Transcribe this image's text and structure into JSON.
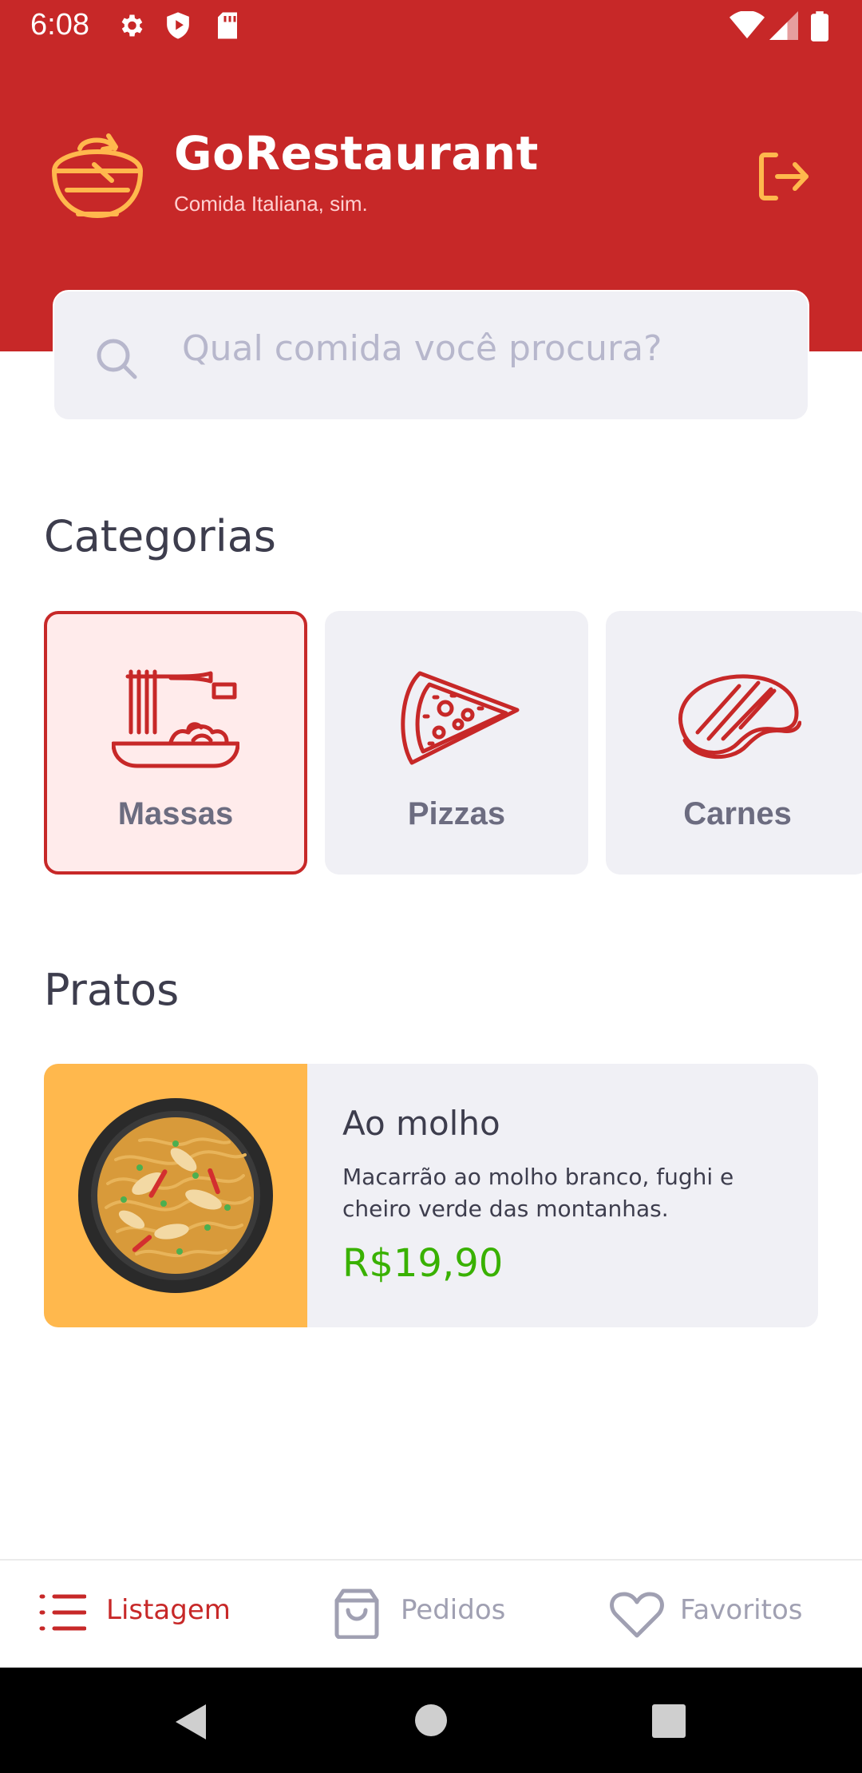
{
  "status_bar": {
    "time": "6:08"
  },
  "header": {
    "title": "GoRestaurant",
    "subtitle": "Comida Italiana, sim.",
    "logo_icon": "bowl-icon",
    "logout_icon": "logout-icon"
  },
  "search": {
    "placeholder": "Qual comida você procura?"
  },
  "categories": {
    "title": "Categorias",
    "items": [
      {
        "label": "Massas",
        "icon": "pasta-icon",
        "selected": true
      },
      {
        "label": "Pizzas",
        "icon": "pizza-icon",
        "selected": false
      },
      {
        "label": "Carnes",
        "icon": "steak-icon",
        "selected": false
      }
    ]
  },
  "dishes": {
    "title": "Pratos",
    "items": [
      {
        "name": "Ao molho",
        "description": "Macarrão ao molho branco, fughi e cheiro verde das montanhas.",
        "price": "R$19,90"
      }
    ]
  },
  "tabs": [
    {
      "label": "Listagem",
      "icon": "list-icon",
      "active": true
    },
    {
      "label": "Pedidos",
      "icon": "bag-icon",
      "active": false
    },
    {
      "label": "Favoritos",
      "icon": "heart-icon",
      "active": false
    }
  ],
  "colors": {
    "primary": "#c72828",
    "accent": "#ffb84d",
    "price": "#39b100",
    "card": "#f0f0f5",
    "text": "#3d3d4d",
    "muted": "#a0a0b2"
  }
}
